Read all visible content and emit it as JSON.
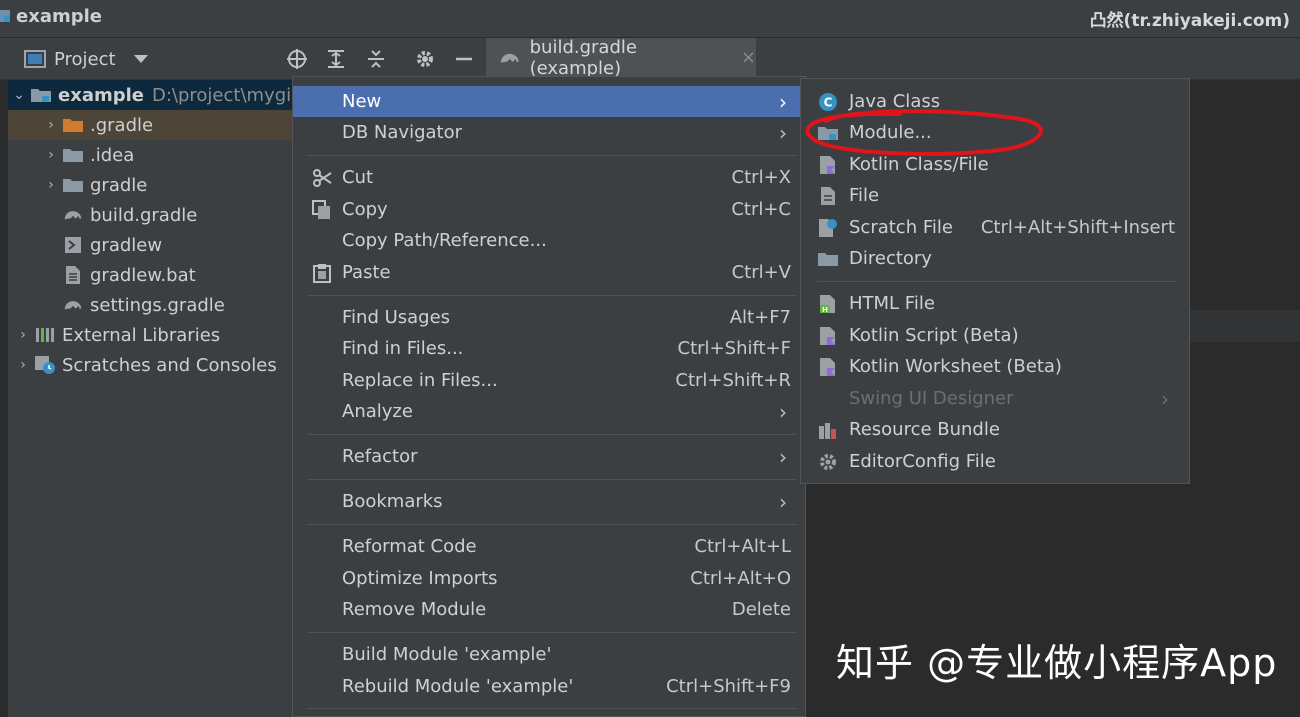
{
  "title_bar": {
    "title": "example",
    "watermark": "凸然(tr.zhiyakeji.com)"
  },
  "toolbar": {
    "project_selector": "Project",
    "tab": {
      "label": "build.gradle (example)",
      "close": "×"
    }
  },
  "tree": {
    "root": {
      "label": "example",
      "path": "D:\\project\\mygi"
    },
    "items": [
      {
        "label": ".gradle"
      },
      {
        "label": ".idea"
      },
      {
        "label": "gradle"
      },
      {
        "label": "build.gradle"
      },
      {
        "label": "gradlew"
      },
      {
        "label": "gradlew.bat"
      },
      {
        "label": "settings.gradle"
      },
      {
        "label": "External Libraries"
      },
      {
        "label": "Scratches and Consoles"
      }
    ]
  },
  "context_menu": {
    "items": [
      {
        "label": "New",
        "shortcut": ""
      },
      {
        "label": "DB Navigator",
        "shortcut": ""
      },
      {
        "label": "Cut",
        "shortcut": "Ctrl+X"
      },
      {
        "label": "Copy",
        "shortcut": "Ctrl+C"
      },
      {
        "label": "Copy Path/Reference...",
        "shortcut": ""
      },
      {
        "label": "Paste",
        "shortcut": "Ctrl+V"
      },
      {
        "label": "Find Usages",
        "shortcut": "Alt+F7"
      },
      {
        "label": "Find in Files...",
        "shortcut": "Ctrl+Shift+F"
      },
      {
        "label": "Replace in Files...",
        "shortcut": "Ctrl+Shift+R"
      },
      {
        "label": "Analyze",
        "shortcut": ""
      },
      {
        "label": "Refactor",
        "shortcut": ""
      },
      {
        "label": "Bookmarks",
        "shortcut": ""
      },
      {
        "label": "Reformat Code",
        "shortcut": "Ctrl+Alt+L"
      },
      {
        "label": "Optimize Imports",
        "shortcut": "Ctrl+Alt+O"
      },
      {
        "label": "Remove Module",
        "shortcut": "Delete"
      },
      {
        "label": "Build Module 'example'",
        "shortcut": ""
      },
      {
        "label": "Rebuild Module 'example'",
        "shortcut": "Ctrl+Shift+F9"
      }
    ]
  },
  "submenu": {
    "items": [
      {
        "label": "Java Class",
        "shortcut": ""
      },
      {
        "label": "Module...",
        "shortcut": ""
      },
      {
        "label": "Kotlin Class/File",
        "shortcut": ""
      },
      {
        "label": "File",
        "shortcut": ""
      },
      {
        "label": "Scratch File",
        "shortcut": "Ctrl+Alt+Shift+Insert"
      },
      {
        "label": "Directory",
        "shortcut": ""
      },
      {
        "label": "HTML File",
        "shortcut": ""
      },
      {
        "label": "Kotlin Script (Beta)",
        "shortcut": ""
      },
      {
        "label": "Kotlin Worksheet (Beta)",
        "shortcut": ""
      },
      {
        "label": "Swing UI Designer",
        "shortcut": ""
      },
      {
        "label": "Resource Bundle",
        "shortcut": ""
      },
      {
        "label": "EditorConfig File",
        "shortcut": ""
      }
    ]
  },
  "watermark_bottom": "知乎 @专业做小程序App",
  "colors": {
    "selection": "#4b6eaf",
    "annotation": "#e0141b",
    "panel": "#3c3f41",
    "editor": "#2b2b2b"
  }
}
